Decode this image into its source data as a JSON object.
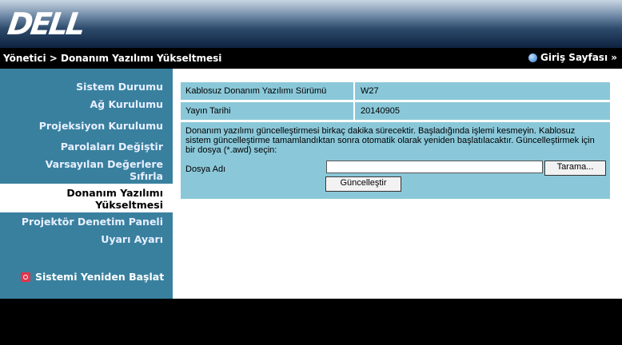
{
  "header": {
    "logo_text": "DELL"
  },
  "pathbar": {
    "breadcrumb": "Yönetici > Donanım Yazılımı Yükseltmesi",
    "home_label": "Giriş Sayfası »"
  },
  "sidebar": {
    "items": [
      {
        "label": "Sistem Durumu"
      },
      {
        "label": "Ağ Kurulumu"
      },
      {
        "label": "Projeksiyon Kurulumu"
      },
      {
        "label": "Parolaları Değiştir"
      },
      {
        "label_line1": "Varsayılan Değerlere",
        "label_line2": "Sıfırla"
      },
      {
        "label_line1": "Donanım Yazılımı",
        "label_line2": "Yükseltmesi",
        "active": true
      },
      {
        "label": "Projektör Denetim Paneli"
      },
      {
        "label": "Uyarı Ayarı"
      }
    ],
    "restart_label": "Sistemi Yeniden Başlat"
  },
  "main": {
    "firmware_version_label": "Kablosuz Donanım Yazılımı Sürümü",
    "firmware_version_value": "W27",
    "release_date_label": "Yayın Tarihi",
    "release_date_value": "20140905",
    "description": "Donanım yazılımı güncelleştirmesi birkaç dakika sürecektir. Başladığında işlemi kesmeyin. Kablosuz sistem güncelleştirme tamamlandıktan sonra otomatik olarak yeniden başlatılacaktır. Güncelleştirmek için bir dosya (*.awd) seçin:",
    "file_name_label": "Dosya Adı",
    "file_input_value": "",
    "browse_button": "Tarama...",
    "update_button": "Güncelleştir"
  }
}
